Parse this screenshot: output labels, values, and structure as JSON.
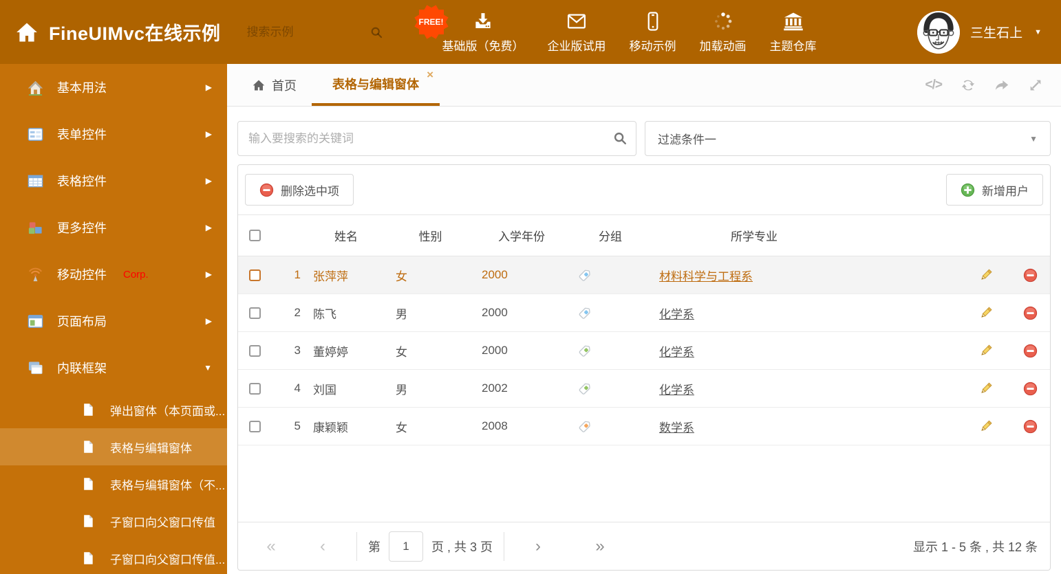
{
  "theme": {
    "header_bg": "#AE6300",
    "sidebar_bg": "#C57109",
    "accent": "#B36605",
    "selected_item_bg": "#D0892F",
    "badge_color": "#FF4902"
  },
  "header": {
    "title": "FineUIMvc在线示例",
    "search_placeholder": "搜索示例",
    "nav_items": [
      {
        "label": "基础版（免费）",
        "icon": "download",
        "badge": "FREE!"
      },
      {
        "label": "企业版试用",
        "icon": "envelope"
      },
      {
        "label": "移动示例",
        "icon": "mobile"
      },
      {
        "label": "加载动画",
        "icon": "spinner"
      },
      {
        "label": "主题仓库",
        "icon": "bank"
      }
    ],
    "user_name": "三生石上"
  },
  "sidebar": {
    "items": [
      {
        "label": "基本用法",
        "icon": "home"
      },
      {
        "label": "表单控件",
        "icon": "form"
      },
      {
        "label": "表格控件",
        "icon": "table"
      },
      {
        "label": "更多控件",
        "icon": "cubes"
      },
      {
        "label": "移动控件",
        "icon": "signal",
        "tag": "Corp."
      },
      {
        "label": "页面布局",
        "icon": "layout"
      },
      {
        "label": "内联框架",
        "icon": "frames",
        "expanded": true
      }
    ],
    "sub_items": [
      {
        "label": "弹出窗体（本页面或..."
      },
      {
        "label": "表格与编辑窗体",
        "active": true
      },
      {
        "label": "表格与编辑窗体（不..."
      },
      {
        "label": "子窗口向父窗口传值"
      },
      {
        "label": "子窗口向父窗口传值..."
      }
    ]
  },
  "tabs": {
    "home": "首页",
    "active": "表格与编辑窗体",
    "close": "×"
  },
  "filter": {
    "search_placeholder": "输入要搜索的关键词",
    "selected": "过滤条件一"
  },
  "grid": {
    "delete_button": "删除选中项",
    "add_button": "新增用户",
    "columns": [
      "姓名",
      "性别",
      "入学年份",
      "分组",
      "所学专业"
    ],
    "tag_colors": {
      "blue": "#85C6F0",
      "green": "#93C463",
      "orange": "#F6A65C"
    },
    "rows": [
      {
        "index": "1",
        "name": "张萍萍",
        "gender": "女",
        "year": "2000",
        "tag": "blue",
        "major": "材料科学与工程系",
        "selected": true
      },
      {
        "index": "2",
        "name": "陈飞",
        "gender": "男",
        "year": "2000",
        "tag": "blue",
        "major": "化学系"
      },
      {
        "index": "3",
        "name": "董婷婷",
        "gender": "女",
        "year": "2000",
        "tag": "green",
        "major": "化学系"
      },
      {
        "index": "4",
        "name": "刘国",
        "gender": "男",
        "year": "2002",
        "tag": "green",
        "major": "化学系"
      },
      {
        "index": "5",
        "name": "康颖颖",
        "gender": "女",
        "year": "2008",
        "tag": "orange",
        "major": "数学系"
      }
    ]
  },
  "pagination": {
    "first": "«",
    "prev": "‹",
    "next": "›",
    "last": "»",
    "page_label_before": "第",
    "page_value": "1",
    "page_label_after": "页 , 共 3 页",
    "summary": "显示 1 - 5 条 , 共 12 条"
  }
}
